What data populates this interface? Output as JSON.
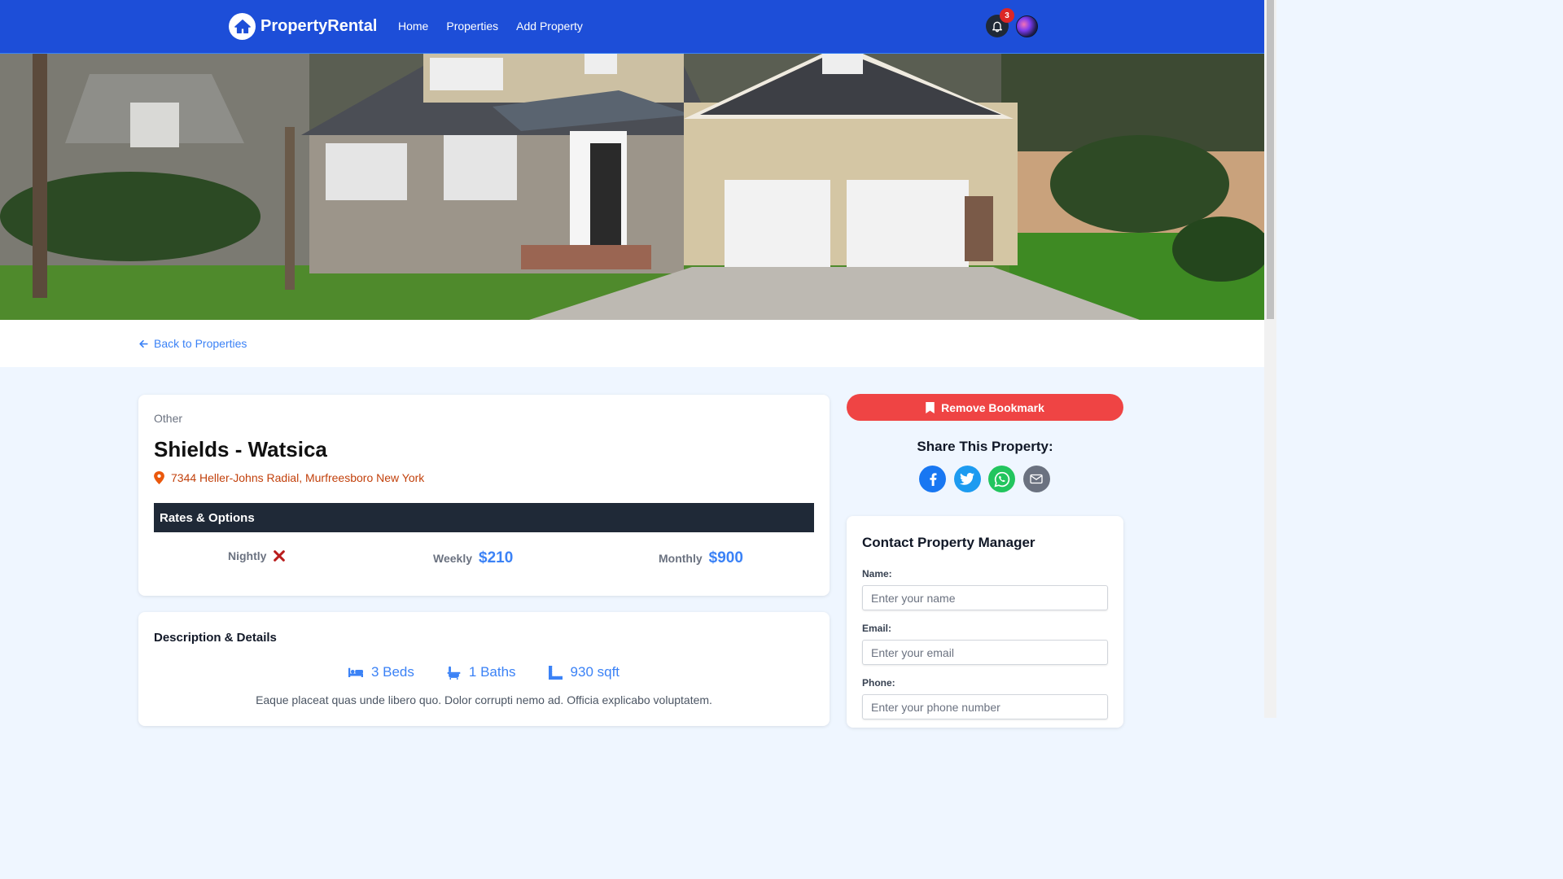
{
  "nav": {
    "brand": "PropertyRental",
    "links": [
      "Home",
      "Properties",
      "Add Property"
    ],
    "notification_count": "3"
  },
  "back_link": "Back to Properties",
  "property": {
    "type": "Other",
    "name": "Shields - Watsica",
    "address": "7344 Heller-Johns Radial, Murfreesboro New York"
  },
  "rates": {
    "title": "Rates & Options",
    "nightly_label": "Nightly",
    "nightly_value": "unavailable",
    "weekly_label": "Weekly",
    "weekly_value": "$210",
    "monthly_label": "Monthly",
    "monthly_value": "$900"
  },
  "details": {
    "title": "Description & Details",
    "beds": "3 Beds",
    "baths": "1 Baths",
    "sqft": "930 sqft",
    "description": "Eaque placeat quas unde libero quo. Dolor corrupti nemo ad. Officia explicabo voluptatem."
  },
  "sidebar": {
    "bookmark_label": "Remove Bookmark",
    "share_title": "Share This Property:",
    "share_icons": [
      "facebook-icon",
      "twitter-icon",
      "whatsapp-icon",
      "email-icon"
    ]
  },
  "contact": {
    "title": "Contact Property Manager",
    "name_label": "Name:",
    "name_placeholder": "Enter your name",
    "email_label": "Email:",
    "email_placeholder": "Enter your email",
    "phone_label": "Phone:",
    "phone_placeholder": "Enter your phone number"
  },
  "colors": {
    "nav_bg": "#1d4ed8",
    "accent": "#3b82f6",
    "danger": "#ef4444",
    "address": "#c2410c",
    "rates_header": "#1f2937"
  }
}
